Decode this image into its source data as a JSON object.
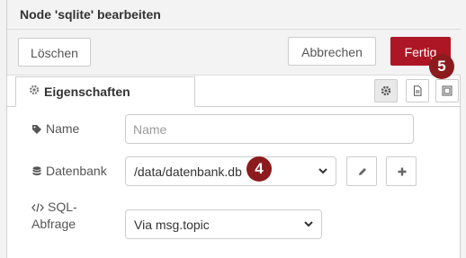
{
  "dialog": {
    "title": "Node 'sqlite' bearbeiten",
    "buttons": {
      "delete_label": "Löschen",
      "cancel_label": "Abbrechen",
      "done_label": "Fertig"
    }
  },
  "tabs": {
    "active_label": "Eigenschaften",
    "icons": [
      "gear-icon",
      "document-icon",
      "frame-icon"
    ]
  },
  "form": {
    "name": {
      "label": "Name",
      "placeholder": "Name",
      "value": ""
    },
    "database": {
      "label": "Datenbank",
      "value": "/data/datenbank.db"
    },
    "sql_query": {
      "label_line1": "SQL-",
      "label_line2": "Abfrage",
      "value": "Via msg.topic"
    }
  },
  "annotations": {
    "badge_done": "5",
    "badge_database": "4"
  },
  "colors": {
    "primary": "#ad1625",
    "badge": "#8c1b1e",
    "toolbar_bg": "#f3f3f3"
  }
}
